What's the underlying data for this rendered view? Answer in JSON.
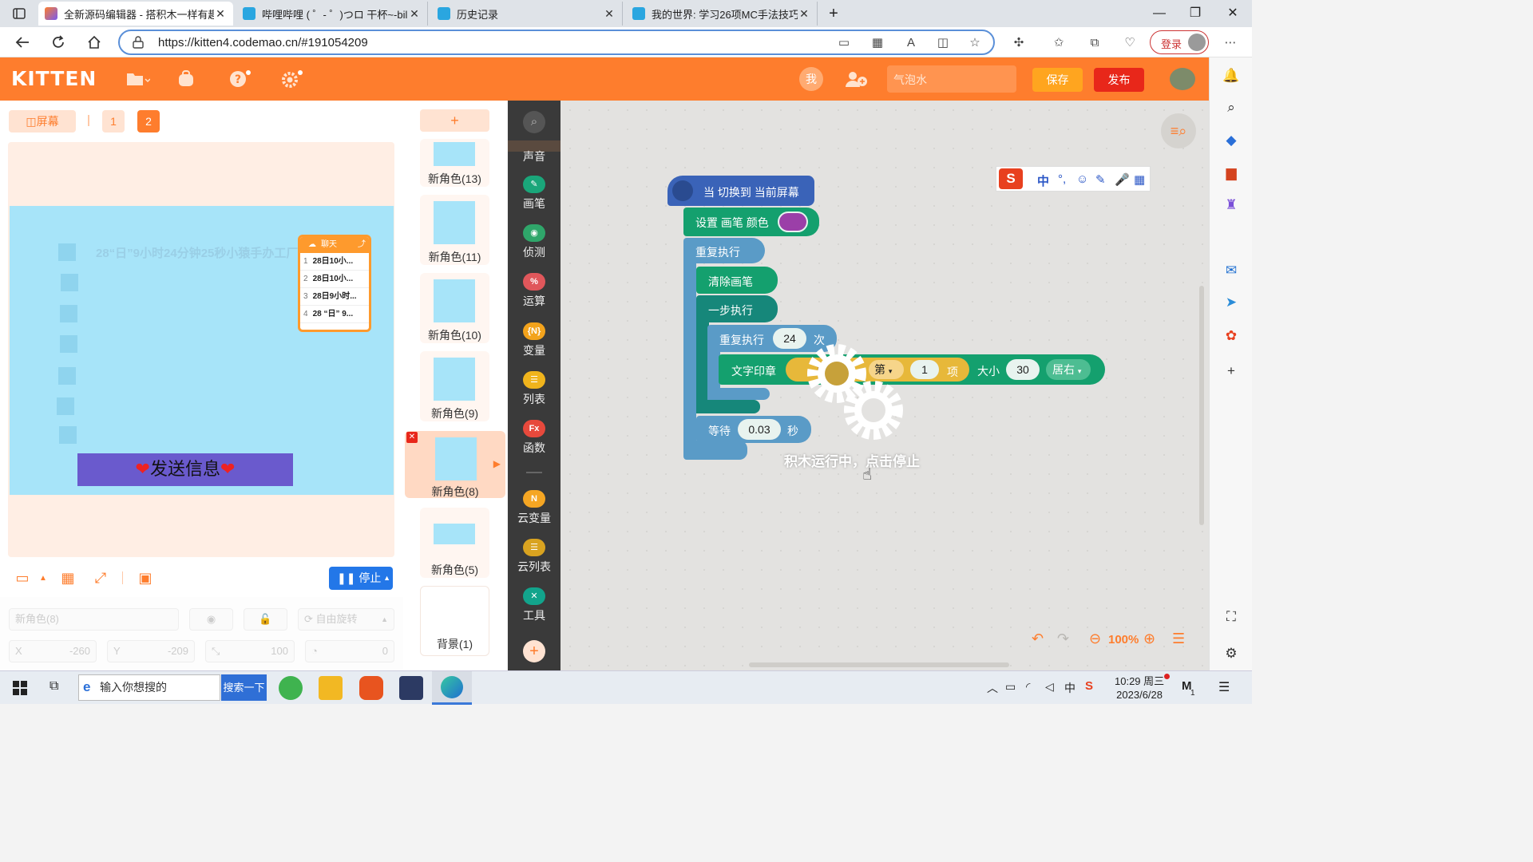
{
  "tabs": [
    {
      "title": "全新源码编辑器 - 搭积木一样有趣",
      "active": true,
      "color": "#fe7d2d"
    },
    {
      "title": "哔哩哔哩 ( ゜- ゜)つロ 干杯~-bilibili",
      "active": false,
      "color": "#2aa6e0"
    },
    {
      "title": "历史记录",
      "active": false,
      "color": "#2aa6e0"
    },
    {
      "title": "我的世界: 学习26项MC手法技巧",
      "active": false,
      "color": "#2aa6e0"
    }
  ],
  "address": {
    "url": "https://kitten4.codemao.cn/#191054209"
  },
  "browser": {
    "login_label": "登录"
  },
  "header": {
    "logo": "KITTEN",
    "me_label": "我",
    "bubble_placeholder": "气泡水",
    "save_label": "保存",
    "publish_label": "发布"
  },
  "stage": {
    "screen_label": "屏幕",
    "pages": [
      "1",
      "2"
    ],
    "marquee_text": "28“日”9小时24分钟25秒小猿手办工厂",
    "chat": {
      "title": "聊天",
      "rows": [
        {
          "n": "1",
          "text": "28日10小..."
        },
        {
          "n": "2",
          "text": "28日10小..."
        },
        {
          "n": "3",
          "text": "28日9小时..."
        },
        {
          "n": "4",
          "text": "28 “日” 9..."
        }
      ]
    },
    "send_label": "发送信息",
    "stop_label": "停止",
    "props": {
      "sprite_name_placeholder": "新角色(8)",
      "rotate_label": "自由旋转",
      "x_label": "X",
      "x_value": "-260",
      "y_label": "Y",
      "y_value": "-209",
      "size_value": "100",
      "dir_value": "0"
    }
  },
  "sprites": {
    "add_label": "+",
    "items": [
      {
        "name": "新角色(13)"
      },
      {
        "name": "新角色(11)"
      },
      {
        "name": "新角色(10)"
      },
      {
        "name": "新角色(9)"
      },
      {
        "name": "新角色(8)",
        "selected": true
      },
      {
        "name": "新角色(5)"
      },
      {
        "name": "背景(1)"
      }
    ]
  },
  "categories": [
    {
      "label": "声音",
      "color": "#e8508a"
    },
    {
      "label": "画笔",
      "color": "#1aa67a"
    },
    {
      "label": "侦测",
      "color": "#2fa66a"
    },
    {
      "label": "运算",
      "color": "#e0575b"
    },
    {
      "label": "变量",
      "color": "#f3a31c",
      "icon": "{N}"
    },
    {
      "label": "列表",
      "color": "#f0b41c"
    },
    {
      "label": "函数",
      "color": "#e7493c",
      "icon": "Fx"
    },
    {
      "label": "云变量",
      "color": "#f5a623",
      "icon": "N"
    },
    {
      "label": "云列表",
      "color": "#d9a320"
    },
    {
      "label": "工具",
      "color": "#12a48c"
    }
  ],
  "blocks": {
    "hat": "当 切换到 当前屏幕",
    "set_pen_color": "设置 画笔 颜色",
    "pen_color": "#9b3fa8",
    "repeat_forever": "重复执行",
    "clear_pen": "清除画笔",
    "step_exec": "一步执行",
    "repeat_n": "重复执行",
    "repeat_count": "24",
    "times": "次",
    "stamp_text": "文字印章",
    "chat_ref": "聊天",
    "item_of": "第",
    "item_index": "1",
    "item_suffix": "项",
    "size_label": "大小",
    "size_value": "30",
    "align": "居右",
    "wait": "等待",
    "wait_value": "0.03",
    "seconds": "秒",
    "running_hint": "积木运行中，点击停止",
    "zoom": "100%"
  },
  "ime": {
    "mode": "中"
  },
  "taskbar": {
    "search_placeholder": "输入你想搜的",
    "search_button": "搜索一下",
    "time": "10:29 周三",
    "date": "2023/6/28",
    "ime_label": "中",
    "badge_count": "1"
  }
}
